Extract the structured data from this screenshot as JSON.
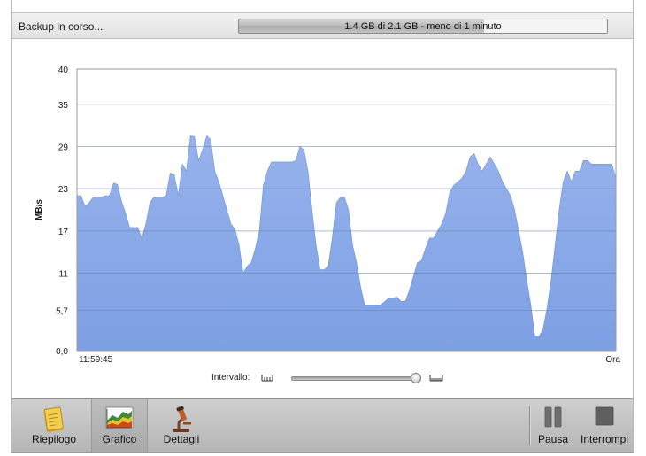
{
  "status": {
    "text": "Backup in corso...",
    "progress_text": "1.4 GB di 2.1 GB - meno di 1 minuto",
    "progress_fraction": 0.667
  },
  "chart_data": {
    "type": "area",
    "ylabel": "MB/s",
    "xlabel": "",
    "yticks": [
      "0,0",
      "5,7",
      "11",
      "17",
      "23",
      "29",
      "35",
      "40"
    ],
    "ytick_values": [
      0,
      5.7,
      11,
      17,
      23,
      29,
      35,
      40
    ],
    "ylim": [
      0,
      40
    ],
    "x_start_label": "11:59:45",
    "x_end_label": "Ora",
    "grid": true,
    "fill_color": "#7d9fe3",
    "values": [
      22,
      22,
      20.5,
      21,
      21.8,
      21.8,
      21.8,
      22,
      22,
      23.8,
      23.6,
      21.2,
      19.5,
      17.5,
      17.5,
      17.5,
      16,
      18,
      21,
      21.8,
      21.8,
      21.8,
      22,
      25.2,
      25,
      22,
      26.5,
      25.5,
      30.5,
      30.4,
      27,
      28.5,
      30.5,
      30,
      25.5,
      24,
      22,
      20,
      18,
      17.2,
      15,
      11,
      12,
      12.5,
      14.5,
      17,
      23.5,
      25.5,
      26.8,
      26.8,
      26.8,
      26.8,
      26.8,
      26.8,
      27,
      29,
      28.5,
      25.5,
      20,
      15,
      11.5,
      11.5,
      12,
      16,
      21,
      21.8,
      21.8,
      20,
      15,
      12.5,
      9,
      6.5,
      6.5,
      6.5,
      6.5,
      6.5,
      7,
      7.5,
      7.5,
      7.6,
      7,
      7,
      8.5,
      10.5,
      12.5,
      12.8,
      14.5,
      16,
      16,
      17,
      18,
      19.5,
      22.5,
      23.5,
      24,
      24.5,
      25.5,
      27.5,
      28,
      26.5,
      25.5,
      26.5,
      27.5,
      26.5,
      25.5,
      24,
      23,
      22,
      20,
      17,
      14,
      10,
      6.5,
      2,
      2,
      3,
      6,
      10,
      15,
      20,
      24,
      25.5,
      24,
      25.5,
      25.5,
      27,
      27,
      26.5,
      26.5,
      26.5,
      26.5,
      26.5,
      26.5,
      24.5
    ]
  },
  "interval": {
    "label": "Intervallo:",
    "value_fraction": 0.97
  },
  "toolbar": {
    "summary_label": "Riepilogo",
    "graph_label": "Grafico",
    "details_label": "Dettagli",
    "pause_label": "Pausa",
    "stop_label": "Interrompi"
  },
  "icons": {
    "summary": "notepad-icon",
    "graph": "area-chart-icon",
    "details": "microscope-icon",
    "pause": "pause-icon",
    "stop": "stop-icon"
  }
}
